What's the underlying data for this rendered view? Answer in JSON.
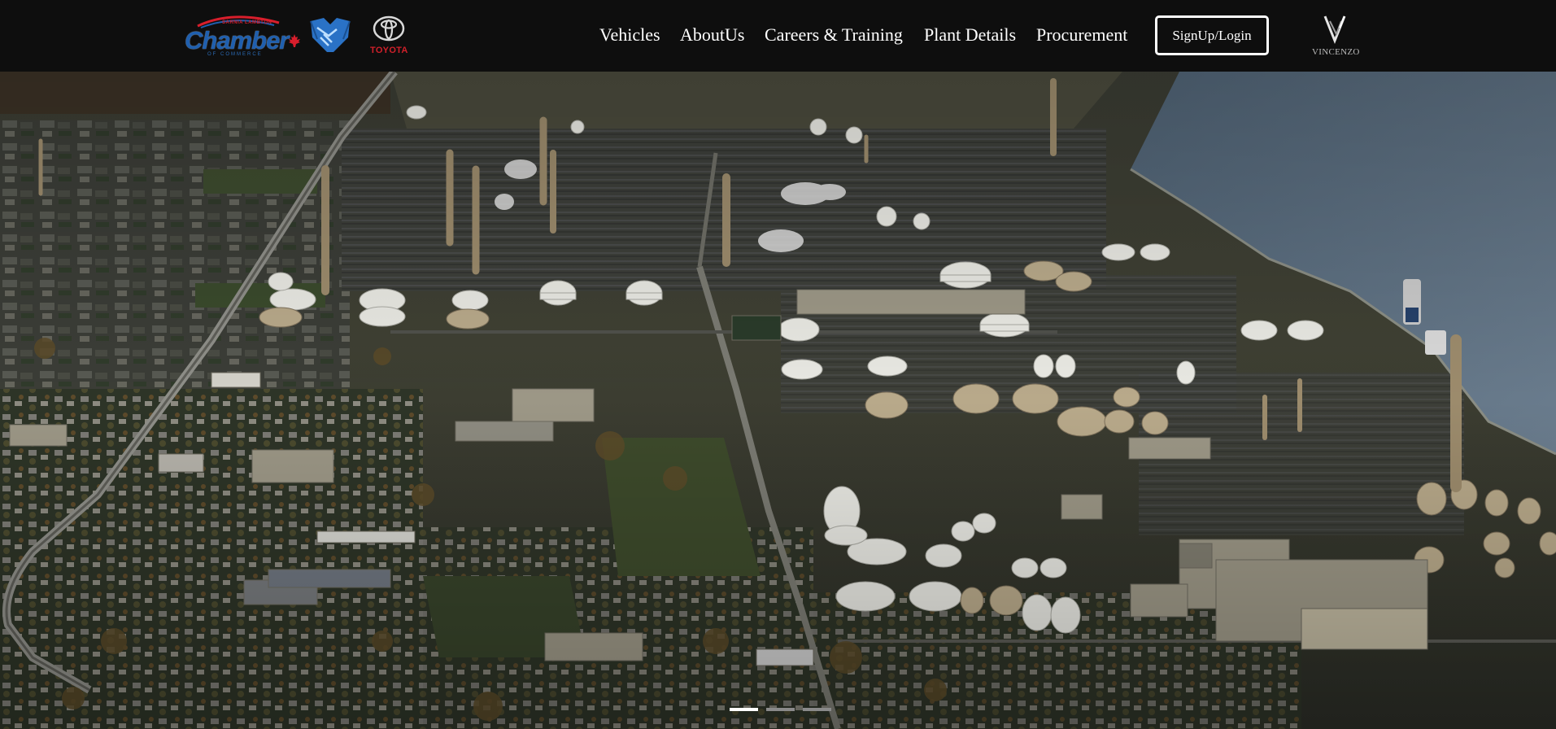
{
  "header": {
    "logos": {
      "chamber": {
        "small_top": "SARNIA LAMBTON",
        "word": "Chamber",
        "bottom": "OF COMMERCE",
        "icon": "chamber-of-commerce-logo"
      },
      "handshake": {
        "icon": "handshake-logo"
      },
      "toyota": {
        "word": "TOYOTA",
        "icon": "toyota-logo"
      },
      "vincenzo": {
        "word": "VINCENZO",
        "icon": "vincenzo-logo"
      }
    },
    "nav": [
      {
        "label": "Vehicles"
      },
      {
        "label": "AboutUs"
      },
      {
        "label": "Careers & Training"
      },
      {
        "label": "Plant Details"
      },
      {
        "label": "Procurement"
      }
    ],
    "signup_label": "SignUp/Login"
  },
  "hero": {
    "image": "aerial-refinery-photo",
    "carousel": {
      "slides": 3,
      "active": 1
    }
  },
  "colors": {
    "header_bg": "#0e0e0e",
    "nav_text": "#ffffff",
    "chamber_blue": "#1f5fae",
    "toyota_red": "#d0202a",
    "river": "#566879"
  }
}
